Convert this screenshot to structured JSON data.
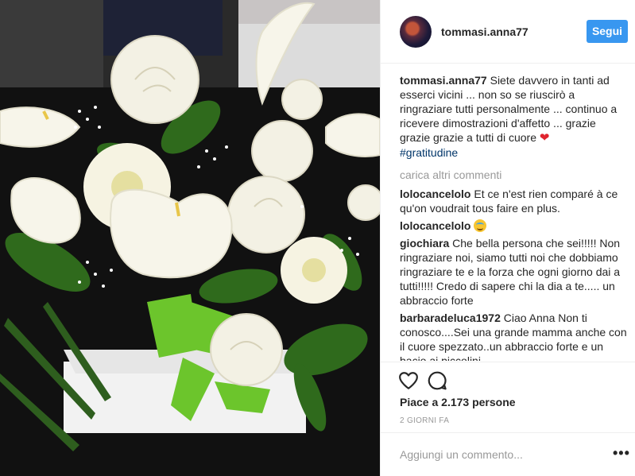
{
  "post": {
    "username": "tommasi.anna77",
    "follow_label": "Segui",
    "caption": {
      "username": "tommasi.anna77",
      "text": "Siete davvero in tanti ad esserci vicini ... non so se riuscirò a ringraziare tutti personalmente ... continuo a ricevere dimostrazioni d'affetto ... grazie grazie grazie a tutti di cuore",
      "emoji": "heart-emoji",
      "hashtag": "#gratitudine"
    },
    "load_more_label": "carica altri commenti",
    "comments": [
      {
        "username": "lolocancelolo",
        "text": "Et ce n'est rien comparé à ce qu'on voudrait tous faire en plus."
      },
      {
        "username": "lolocancelolo",
        "text": "",
        "emoji": "smiling-face-halo-emoji"
      },
      {
        "username": "giochiara",
        "text": "Che bella persona che sei!!!!! Non ringraziare noi, siamo tutti noi che dobbiamo ringraziare te e la forza che ogni giorno dai a tutti!!!!! Credo di sapere chi la dia a te..... un abbraccio forte"
      },
      {
        "username": "barbaradeluca1972",
        "text": "Ciao Anna Non ti conosco....Sei una grande mamma anche con il cuore spezzato..un abbraccio forte e un bacio ai piccolini"
      }
    ],
    "likes_label": "Piace a 2.173 persone",
    "time_label": "2 GIORNI FA",
    "add_comment_placeholder": "Aggiungi un commento...",
    "more_label": "•••",
    "icons": [
      "heart-icon",
      "comment-icon",
      "more-options-icon"
    ],
    "colors": {
      "accent": "#3897f0",
      "hashtag": "#003569",
      "muted": "#999999",
      "border": "#efefef"
    }
  }
}
